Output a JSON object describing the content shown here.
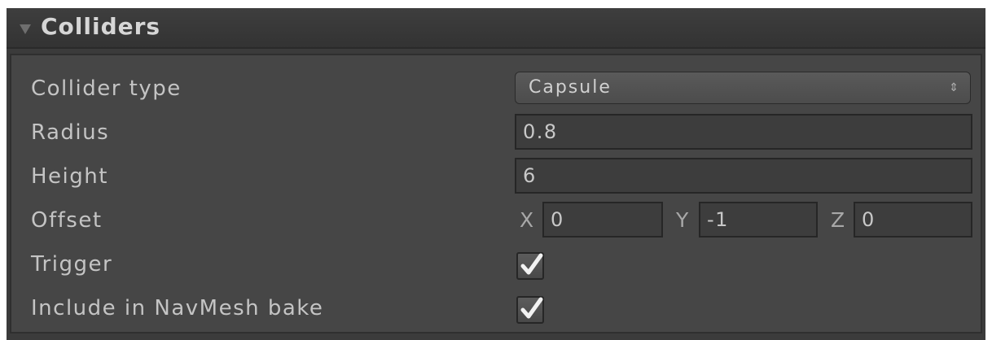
{
  "section": {
    "title": "Colliders",
    "expanded_icon": "triangle-down-icon"
  },
  "rows": {
    "collider_type": {
      "label": "Collider type",
      "value": "Capsule",
      "arrow_icon": "up-down-arrows-icon"
    },
    "radius": {
      "label": "Radius",
      "value": "0.8"
    },
    "height": {
      "label": "Height",
      "value": "6"
    },
    "offset": {
      "label": "Offset",
      "x_label": "X",
      "x_value": "0",
      "y_label": "Y",
      "y_value": "-1",
      "z_label": "Z",
      "z_value": "0"
    },
    "trigger": {
      "label": "Trigger",
      "checked": true
    },
    "navmesh": {
      "label": "Include in NavMesh bake",
      "checked": true
    }
  },
  "colors": {
    "background": "#464646",
    "header": "#383838",
    "text": "#c4c4c4",
    "field": "#3d3d3d"
  }
}
